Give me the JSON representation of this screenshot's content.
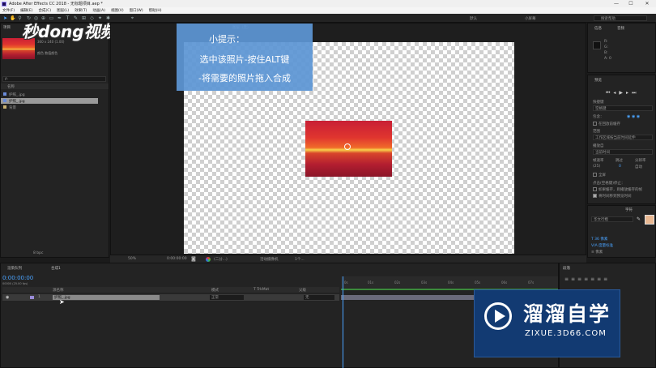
{
  "window": {
    "title": "Adobe After Effects CC 2018 - 无标题项目.aep *",
    "minimize": "—",
    "maximize": "☐",
    "close": "✕"
  },
  "menu": [
    "文件(F)",
    "编辑(E)",
    "合成(C)",
    "图层(L)",
    "效果(T)",
    "动画(A)",
    "视图(V)",
    "窗口(W)",
    "帮助(H)"
  ],
  "toolbar": {
    "workspace_labels": [
      "默认",
      "小屏幕"
    ],
    "search_placeholder": "搜索帮助"
  },
  "project_panel": {
    "tab": "项目",
    "thumb_line1": "360 x 240 (1.00)",
    "thumb_line2": "颜色 数值颜色",
    "search_placeholder": "ρ.",
    "col_name": "名称",
    "items": [
      {
        "name": "护照_.jpg",
        "selected": false
      },
      {
        "name": "护照_.jpg",
        "selected": true
      },
      {
        "name": "背景",
        "selected": false
      }
    ],
    "bpc": "8 bpc"
  },
  "center_panel": {
    "tab_left": "合成: 合成1",
    "tab_layer": "图层（无）",
    "zoom": "50%",
    "timecode": "0:00:00:00",
    "resolution": "(二分...)",
    "camera": "活动摄像机",
    "views": "1个..."
  },
  "hint": {
    "title": "小提示：",
    "line1": "选中该照片-按住ALT键",
    "line2": "-将需要的照片拖入合成"
  },
  "watermark": {
    "logo_text": "秒dong视频"
  },
  "right_panel": {
    "info_tab": "信息",
    "audio_tab": "音频",
    "info_values": [
      "R:",
      "G:",
      "B:",
      "A: 0"
    ],
    "preview_tab": "预览",
    "shortcut_label": "快捷键",
    "shortcut_value": "空格键",
    "include_label": "包含：",
    "cache_label": "在回放前缓存",
    "range_label": "范围",
    "range_value": "工作区域按当前时间延伸",
    "play_from_label": "播放自",
    "play_from_value": "当前时间",
    "framerate_label": "帧速率",
    "skip_label": "跳过",
    "resolution_label": "分辨率",
    "framerate_value": "(25)",
    "skip_value": "0",
    "res_value": "自动",
    "fullscreen_label": "全屏",
    "stop_label": "点击(空格键)停止：",
    "stop_opt1": "如果缓存，则播放缓存的帧",
    "stop_opt2": "将时间移到预览时间",
    "char_tab": "字符",
    "para_tab": "段落",
    "font_value": "华文行楷"
  },
  "timeline": {
    "render_queue_tab": "渲染队列",
    "comp_tab": "合成1",
    "timecode": "0:00:00:00",
    "fps_sub": "00000 (25.00 fps)",
    "col_source": "源名称",
    "col_mode": "模式",
    "col_trkmat": "T TrkMat",
    "col_parent": "父级",
    "layer_index": "1",
    "layer_name": "护照_.jpg",
    "layer_mode": "正常",
    "layer_parent": "无",
    "ruler": [
      "0s",
      "01s",
      "02s",
      "03s",
      "04s",
      "05s",
      "06s",
      "07s"
    ],
    "align_tab": "段落"
  },
  "brand": {
    "name": "溜溜自学",
    "url": "ZIXUE.3D66.COM"
  },
  "colors": {
    "hint_bg": "#5c96d4",
    "brand_bg": "#123a72",
    "accent": "#2d8ceb",
    "timeline_green": "#3c8a3c",
    "char_fill_swatch": "#e9b892"
  }
}
